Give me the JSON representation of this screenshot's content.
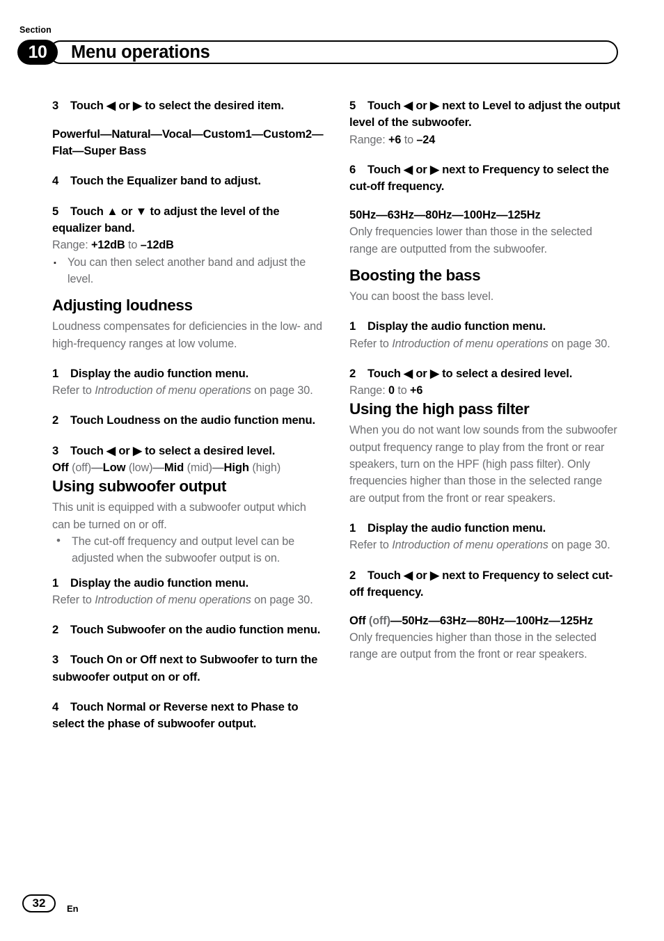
{
  "header": {
    "section_label": "Section",
    "section_number": "10",
    "title": "Menu operations"
  },
  "footer": {
    "page_number": "32",
    "language": "En"
  },
  "left_column": {
    "step3": {
      "num": "3",
      "text": "Touch ◀ or ▶ to select the desired item.",
      "options": "Powerful—Natural—Vocal—Custom1—Custom2—Flat—Super Bass"
    },
    "step4": {
      "num": "4",
      "text": "Touch the Equalizer band to adjust."
    },
    "step5": {
      "num": "5",
      "text": "Touch ▲ or ▼ to adjust the level of the equalizer band.",
      "range_label": "Range:",
      "range_from": "+12dB",
      "range_sep": "to",
      "range_to": "–12dB",
      "note_bullet": "▪",
      "note": "You can then select another band and adjust the level."
    },
    "loudness": {
      "heading": "Adjusting loudness",
      "intro": "Loudness compensates for deficiencies in the low- and high-frequency ranges at low volume.",
      "step1": {
        "num": "1",
        "text": "Display the audio function menu.",
        "refer_prefix": "Refer to",
        "refer_italic": "Introduction of menu operations",
        "refer_suffix": "on page 30."
      },
      "step2": {
        "num": "2",
        "text": "Touch Loudness on the audio function menu."
      },
      "step3": {
        "num": "3",
        "text": "Touch ◀ or ▶ to select a desired level.",
        "options_parts": [
          {
            "bold": "Off",
            "plain": " (off)"
          },
          {
            "bold": "Low",
            "plain": " (low)"
          },
          {
            "bold": "Mid",
            "plain": " (mid)"
          },
          {
            "bold": "High",
            "plain": " (high)"
          }
        ],
        "separator": "—"
      }
    },
    "subwoofer": {
      "heading": "Using subwoofer output",
      "intro": "This unit is equipped with a subwoofer output which can be turned on or off.",
      "note_bullet": "•",
      "note": "The cut-off frequency and output level can be adjusted when the subwoofer output is on.",
      "step1": {
        "num": "1",
        "text": "Display the audio function menu.",
        "refer_prefix": "Refer to",
        "refer_italic": "Introduction of menu operations",
        "refer_suffix": "on page 30."
      },
      "step2": {
        "num": "2",
        "text": "Touch Subwoofer on the audio function menu."
      },
      "step3": {
        "num": "3",
        "text": "Touch On or Off next to Subwoofer to turn the subwoofer output on or off."
      },
      "step4": {
        "num": "4",
        "text": "Touch Normal or Reverse next to Phase to select the phase of subwoofer output."
      }
    }
  },
  "right_column": {
    "step5": {
      "num": "5",
      "text": "Touch ◀ or ▶ next to Level to adjust the output level of the subwoofer.",
      "range_label": "Range:",
      "range_from": "+6",
      "range_sep": "to",
      "range_to": "–24"
    },
    "step6": {
      "num": "6",
      "text": "Touch ◀ or ▶ next to Frequency to select the cut-off frequency.",
      "options": "50Hz—63Hz—80Hz—100Hz—125Hz",
      "note": "Only frequencies lower than those in the selected range are outputted from the subwoofer."
    },
    "bass": {
      "heading": "Boosting the bass",
      "intro": "You can boost the bass level.",
      "step1": {
        "num": "1",
        "text": "Display the audio function menu.",
        "refer_prefix": "Refer to",
        "refer_italic": "Introduction of menu operations",
        "refer_suffix": "on page 30."
      },
      "step2": {
        "num": "2",
        "text": "Touch ◀ or ▶ to select a desired level.",
        "range_label": "Range:",
        "range_from": "0",
        "range_sep": "to",
        "range_to": "+6"
      }
    },
    "hpf": {
      "heading": "Using the high pass filter",
      "intro": "When you do not want low sounds from the subwoofer output frequency range to play from the front or rear speakers, turn on the HPF (high pass filter). Only frequencies higher than those in the selected range are output from the front or rear speakers.",
      "step1": {
        "num": "1",
        "text": "Display the audio function menu.",
        "refer_prefix": "Refer to",
        "refer_italic": "Introduction of menu operations",
        "refer_suffix": "on page 30."
      },
      "step2": {
        "num": "2",
        "text": "Touch ◀ or ▶ next to Frequency to select cut-off frequency.",
        "options_off_bold": "Off",
        "options_off_plain": " (off)",
        "options_rest": "—50Hz—63Hz—80Hz—100Hz—125Hz",
        "note": "Only frequencies higher than those in the selected range are output from the front or rear speakers."
      }
    }
  }
}
